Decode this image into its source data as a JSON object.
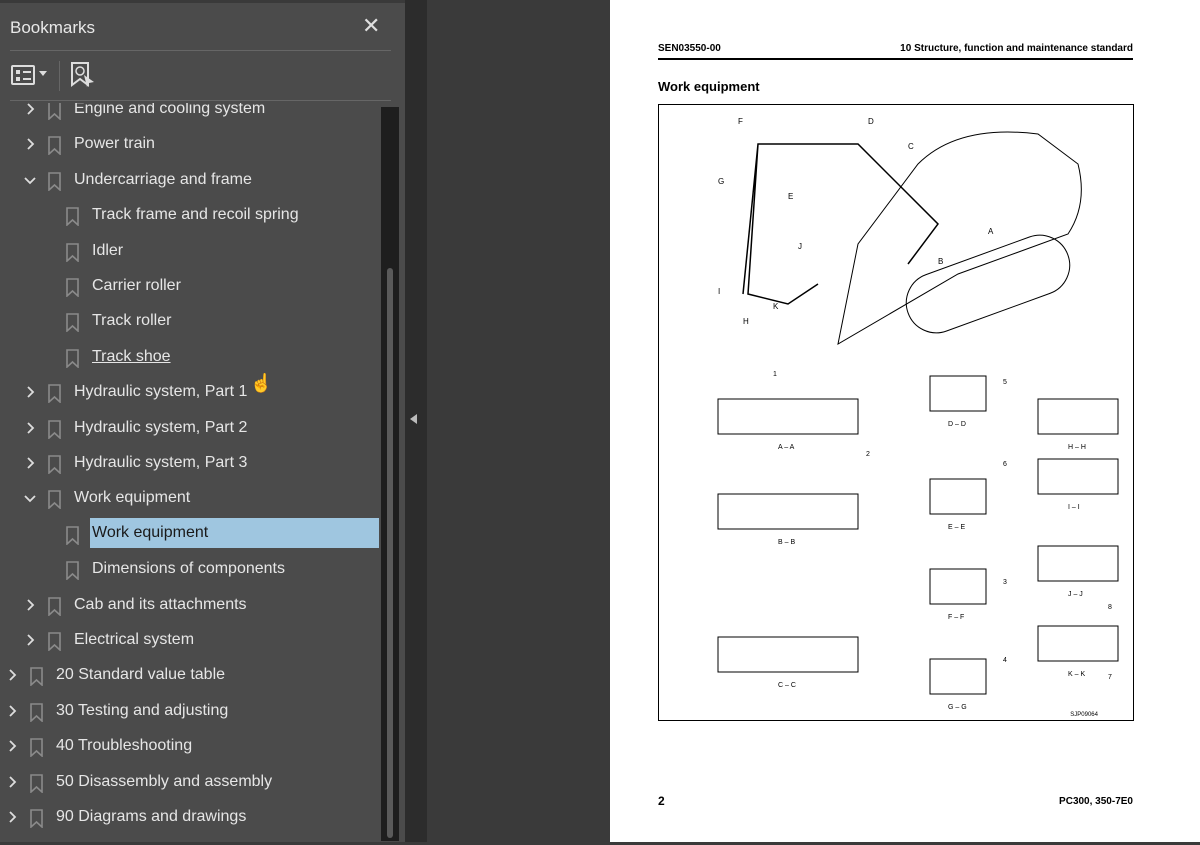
{
  "sidebar": {
    "title": "Bookmarks",
    "close_icon": "close-icon",
    "items": [
      {
        "label": "Engine and cooling system",
        "level": 1,
        "state": "collapsed"
      },
      {
        "label": "Power train",
        "level": 1,
        "state": "collapsed"
      },
      {
        "label": "Undercarriage and frame",
        "level": 1,
        "state": "expanded"
      },
      {
        "label": "Track frame and recoil spring",
        "level": 2
      },
      {
        "label": "Idler",
        "level": 2
      },
      {
        "label": "Carrier roller",
        "level": 2
      },
      {
        "label": "Track roller",
        "level": 2
      },
      {
        "label": "Track shoe",
        "level": 2,
        "hover": true
      },
      {
        "label": "Hydraulic system, Part 1",
        "level": 1,
        "state": "collapsed"
      },
      {
        "label": "Hydraulic system, Part 2",
        "level": 1,
        "state": "collapsed"
      },
      {
        "label": "Hydraulic system, Part 3",
        "level": 1,
        "state": "collapsed"
      },
      {
        "label": "Work equipment",
        "level": 1,
        "state": "expanded"
      },
      {
        "label": "Work equipment",
        "level": 2,
        "selected": true
      },
      {
        "label": "Dimensions of components",
        "level": 2
      },
      {
        "label": "Cab and its attachments",
        "level": 1,
        "state": "collapsed"
      },
      {
        "label": "Electrical system",
        "level": 1,
        "state": "collapsed"
      },
      {
        "label": "20 Standard value table",
        "level": 0,
        "state": "collapsed"
      },
      {
        "label": "30 Testing and adjusting",
        "level": 0,
        "state": "collapsed"
      },
      {
        "label": "40 Troubleshooting",
        "level": 0,
        "state": "collapsed"
      },
      {
        "label": "50 Disassembly and assembly",
        "level": 0,
        "state": "collapsed"
      },
      {
        "label": "90 Diagrams and drawings",
        "level": 0,
        "state": "collapsed"
      }
    ]
  },
  "page": {
    "doc_code": "SEN03550-00",
    "section": "10 Structure, function and maintenance standard",
    "heading": "Work equipment",
    "page_number": "2",
    "model": "PC300, 350-7E0",
    "figure": {
      "code": "SJP09064",
      "callouts": [
        "A",
        "B",
        "C",
        "D",
        "E",
        "F",
        "G",
        "H",
        "I",
        "J",
        "K"
      ],
      "views": [
        "A – A",
        "B – B",
        "C – C",
        "D – D",
        "E – E",
        "F – F",
        "G – G",
        "H – H",
        "I – I",
        "J – J",
        "K – K"
      ],
      "numbers": [
        "1",
        "2",
        "3",
        "4",
        "5",
        "6",
        "7",
        "8"
      ]
    }
  },
  "colors": {
    "selection": "#9fc6e0",
    "sidebar_bg": "#4b4b4b"
  }
}
